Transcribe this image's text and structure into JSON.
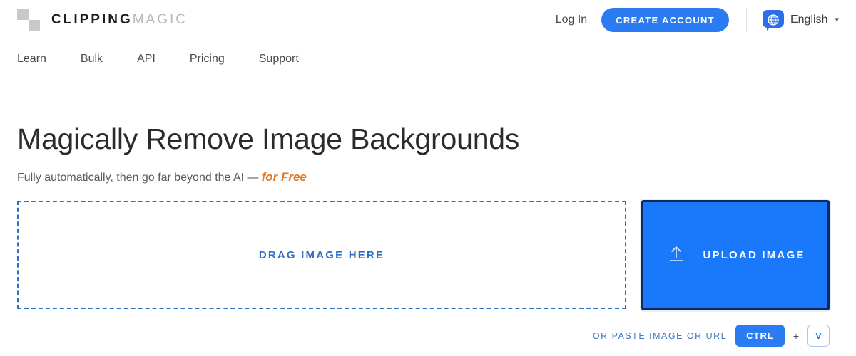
{
  "header": {
    "brand": {
      "name_primary": "CLIPPING",
      "name_secondary": "MAGIC",
      "logo_icon": "checkerboard-logo-icon"
    },
    "login_label": "Log In",
    "create_account_label": "CREATE ACCOUNT",
    "language": {
      "icon": "globe-speech-bubble-icon",
      "label": "English",
      "chevron": "∨"
    },
    "accent_color": "#2b7bf3"
  },
  "nav": {
    "items": [
      {
        "label": "Learn"
      },
      {
        "label": "Bulk"
      },
      {
        "label": "API"
      },
      {
        "label": "Pricing"
      },
      {
        "label": "Support"
      }
    ]
  },
  "hero": {
    "title": "Magically Remove Image Backgrounds",
    "subtitle_plain": "Fully automatically, then go far beyond the AI —",
    "subtitle_highlight": "for Free",
    "highlight_color": "#e8751a"
  },
  "dropzone": {
    "label": "DRAG IMAGE HERE",
    "border_color": "#2f6fc0"
  },
  "upload": {
    "label": "UPLOAD IMAGE",
    "icon": "upload-arrow-icon",
    "fill_color": "#1a79fb",
    "border_color": "#0d2a5c"
  },
  "paste_hint": {
    "text_before": "OR PASTE IMAGE OR",
    "url_label": "URL",
    "key_primary": "CTRL",
    "separator": "+",
    "key_secondary": "V"
  }
}
